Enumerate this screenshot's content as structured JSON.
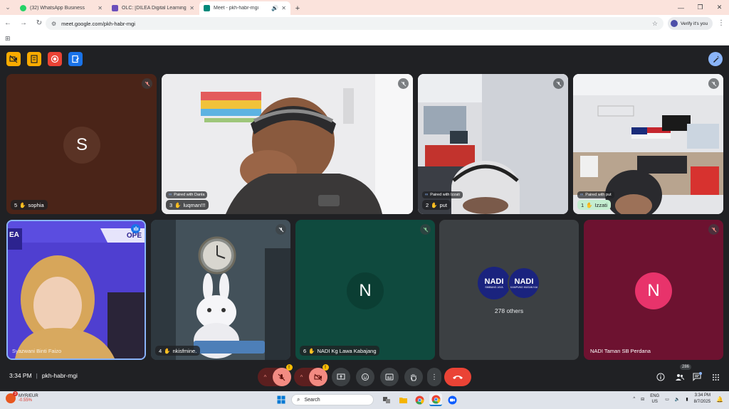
{
  "browser": {
    "tabs": [
      {
        "title": "(32) WhatsApp Business",
        "favicon_color": "#25d366",
        "active": false
      },
      {
        "title": "OLC: [DILEA Digital Learning] C",
        "favicon_color": "#6b4fbb",
        "active": false
      },
      {
        "title": "Meet - pkh-habr-mgi",
        "favicon_color": "#00897b",
        "active": true
      }
    ],
    "url": "meet.google.com/pkh-habr-mgi",
    "profile_label": "Verify it's you"
  },
  "meet": {
    "tiles": [
      {
        "num": "5",
        "name": "sophia",
        "initial": "S",
        "avatar_color": "#5a2a1e",
        "bg": "#4a2418"
      },
      {
        "num": "3",
        "name": "luqman!!!",
        "paired": "Paired with Danla"
      },
      {
        "num": "2",
        "name": "put",
        "paired": "Paired with Izzati"
      },
      {
        "num": "1",
        "name": "Izzati",
        "paired": "Paired with put"
      },
      {
        "name": "Syazwani Binti Faizo",
        "banner": "OPE",
        "logo": "EA"
      },
      {
        "num": "4",
        "name": "nkisfmine."
      },
      {
        "num": "6",
        "name": "NADI Kg Lawa Kabajang",
        "initial": "N",
        "avatar_color": "#0b5345",
        "bg": "#0f4a3e"
      },
      {
        "others_label": "278 others",
        "logo_text": "NADI",
        "logo_sub_1": "SIMBANG JAYA",
        "logo_sub_2": "KAMPUNG MUSAN KAI"
      },
      {
        "name": "NADI Taman SB Perdana",
        "initial": "N",
        "avatar_color": "#e8336b",
        "bg": "#6d1230"
      }
    ],
    "bottom": {
      "time": "3:34 PM",
      "separator": "|",
      "meeting_code": "pkh-habr-mgi",
      "participants_count": "286"
    }
  },
  "taskbar": {
    "ticker_label": "MYR/EUR",
    "ticker_change": "-0.55%",
    "ticker_badge": "3",
    "search_placeholder": "Search",
    "lang_1": "ENG",
    "lang_2": "US",
    "time": "3:34 PM",
    "date": "8/7/2025"
  }
}
